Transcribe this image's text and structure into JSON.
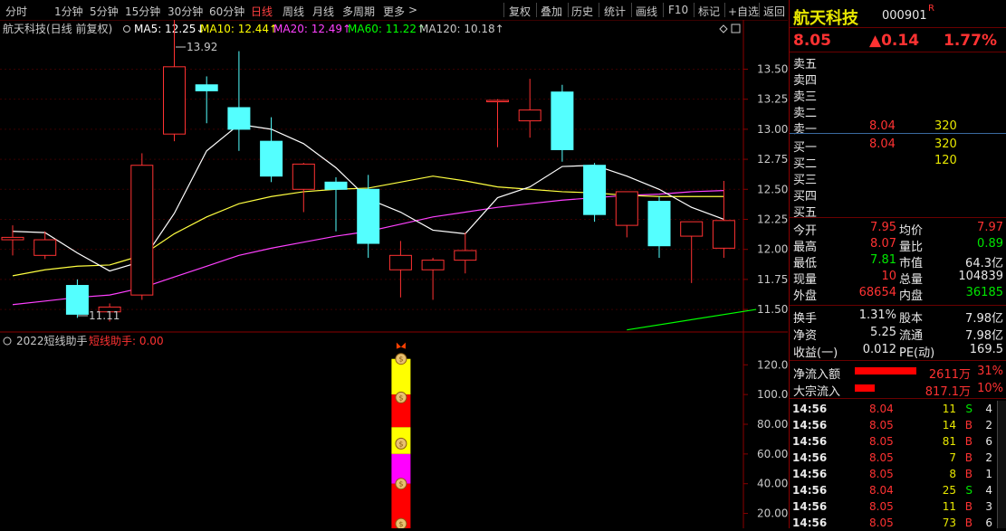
{
  "toolbar": {
    "periods": [
      "分时",
      "1分钟",
      "5分钟",
      "15分钟",
      "30分钟",
      "60分钟",
      "日线",
      "周线",
      "月线",
      "多周期",
      "更多"
    ],
    "active_period": "日线",
    "more_arrow": ">",
    "actions": [
      "复权",
      "叠加",
      "历史",
      "统计",
      "画线",
      "F10",
      "标记",
      "+自选",
      "返回"
    ]
  },
  "main_chart": {
    "title": "航天科技(日线 前复权)",
    "ma": [
      {
        "label": "MA5: 12.25↓",
        "color": "#ffffff"
      },
      {
        "label": "MA10: 12.44↑",
        "color": "#ffff00"
      },
      {
        "label": "MA20: 12.49↑",
        "color": "#ff40ff"
      },
      {
        "label": "MA60: 11.22↑",
        "color": "#00ff00"
      },
      {
        "label": "MA120: 10.18↑",
        "color": "#c8c8c8"
      }
    ],
    "high_label": "13.92",
    "low_label": "11.11"
  },
  "sub_chart": {
    "title": "2022短线助手",
    "indicator": "短线助手: 0.00",
    "money_glyph": "$"
  },
  "chart_data": [
    {
      "type": "candlestick",
      "y_ticks": [
        11.5,
        11.75,
        12.0,
        12.25,
        12.5,
        12.75,
        13.0,
        13.25,
        13.5
      ],
      "ylim": [
        11.35,
        13.85
      ],
      "candles": [
        {
          "o": 12.08,
          "h": 12.2,
          "l": 11.95,
          "c": 12.1
        },
        {
          "o": 11.95,
          "h": 12.15,
          "l": 11.92,
          "c": 12.08
        },
        {
          "o": 11.7,
          "h": 11.75,
          "l": 11.43,
          "c": 11.46
        },
        {
          "o": 11.48,
          "h": 11.55,
          "l": 11.4,
          "c": 11.52
        },
        {
          "o": 11.62,
          "h": 12.8,
          "l": 11.58,
          "c": 12.7
        },
        {
          "o": 12.96,
          "h": 13.92,
          "l": 12.9,
          "c": 13.52
        },
        {
          "o": 13.37,
          "h": 13.44,
          "l": 13.05,
          "c": 13.32
        },
        {
          "o": 13.18,
          "h": 13.65,
          "l": 12.82,
          "c": 13.0
        },
        {
          "o": 12.9,
          "h": 13.1,
          "l": 12.56,
          "c": 12.61
        },
        {
          "o": 12.5,
          "h": 12.72,
          "l": 12.31,
          "c": 12.71
        },
        {
          "o": 12.56,
          "h": 12.6,
          "l": 12.15,
          "c": 12.5
        },
        {
          "o": 12.5,
          "h": 12.62,
          "l": 11.93,
          "c": 12.05
        },
        {
          "o": 11.83,
          "h": 12.07,
          "l": 11.6,
          "c": 11.95
        },
        {
          "o": 11.83,
          "h": 11.93,
          "l": 11.58,
          "c": 11.91
        },
        {
          "o": 11.91,
          "h": 12.14,
          "l": 11.8,
          "c": 11.99
        },
        {
          "o": 13.24,
          "h": 13.25,
          "l": 12.85,
          "c": 13.24
        },
        {
          "o": 13.07,
          "h": 13.42,
          "l": 12.93,
          "c": 13.16
        },
        {
          "o": 13.31,
          "h": 13.37,
          "l": 12.73,
          "c": 12.83
        },
        {
          "o": 12.7,
          "h": 12.72,
          "l": 12.23,
          "c": 12.29
        },
        {
          "o": 12.2,
          "h": 12.4,
          "l": 12.1,
          "c": 12.48
        },
        {
          "o": 12.4,
          "h": 12.44,
          "l": 11.93,
          "c": 12.03
        },
        {
          "o": 12.11,
          "h": 12.21,
          "l": 11.72,
          "c": 12.23
        },
        {
          "o": 12.01,
          "h": 12.57,
          "l": 11.93,
          "c": 12.24
        }
      ],
      "ma5": [
        12.15,
        12.14,
        11.97,
        11.82,
        11.9,
        12.3,
        12.82,
        13.04,
        13.0,
        12.88,
        12.68,
        12.42,
        12.31,
        12.16,
        12.13,
        12.43,
        12.52,
        12.69,
        12.7,
        12.61,
        12.5,
        12.35,
        12.25
      ],
      "ma10": [
        11.78,
        11.83,
        11.86,
        11.87,
        11.95,
        12.13,
        12.27,
        12.38,
        12.44,
        12.48,
        12.5,
        12.51,
        12.56,
        12.61,
        12.57,
        12.52,
        12.5,
        12.48,
        12.47,
        12.45,
        12.44,
        12.44,
        12.44
      ],
      "ma20": [
        11.54,
        11.57,
        11.6,
        11.62,
        11.68,
        11.77,
        11.86,
        11.95,
        12.01,
        12.06,
        12.11,
        12.15,
        12.21,
        12.27,
        12.31,
        12.35,
        12.38,
        12.41,
        12.43,
        12.45,
        12.46,
        12.48,
        12.49
      ],
      "ma60_points": [
        [
          19,
          11.33
        ],
        [
          23,
          11.5
        ]
      ]
    },
    {
      "type": "bar",
      "y_ticks": [
        20,
        40,
        60,
        80,
        100,
        120
      ],
      "ylim": [
        10,
        136
      ],
      "segments": [
        {
          "from": 124,
          "to": 100,
          "color": "#ffff00"
        },
        {
          "from": 100,
          "to": 78,
          "color": "#ff0000"
        },
        {
          "from": 78,
          "to": 60,
          "color": "#ffff00"
        },
        {
          "from": 60,
          "to": 40,
          "color": "#ff00ff"
        },
        {
          "from": 40,
          "to": 10,
          "color": "#ff0000"
        }
      ],
      "coin_levels": [
        124,
        98,
        67,
        40,
        13
      ]
    }
  ],
  "quote": {
    "name": "航天科技",
    "code": "000901",
    "flag": "R",
    "price": "8.05",
    "change": "▲0.14",
    "pct": "1.77%",
    "asks": [
      {
        "label": "卖五",
        "price": "",
        "vol": ""
      },
      {
        "label": "卖四",
        "price": "",
        "vol": ""
      },
      {
        "label": "卖三",
        "price": "",
        "vol": ""
      },
      {
        "label": "卖二",
        "price": "",
        "vol": ""
      },
      {
        "label": "卖一",
        "price": "8.04",
        "vol": "320"
      }
    ],
    "bids": [
      {
        "label": "买一",
        "price": "8.04",
        "vol": "320"
      },
      {
        "label": "买二",
        "price": "",
        "vol": "120"
      },
      {
        "label": "买三",
        "price": "",
        "vol": ""
      },
      {
        "label": "买四",
        "price": "",
        "vol": ""
      },
      {
        "label": "买五",
        "price": "",
        "vol": ""
      }
    ],
    "stats": [
      {
        "l1": "今开",
        "v1": "7.95",
        "c1": "red",
        "l2": "均价",
        "v2": "7.97",
        "c2": "red"
      },
      {
        "l1": "最高",
        "v1": "8.07",
        "c1": "red",
        "l2": "量比",
        "v2": "0.89",
        "c2": "green"
      },
      {
        "l1": "最低",
        "v1": "7.81",
        "c1": "green",
        "l2": "市值",
        "v2": "64.3亿",
        "c2": "white"
      },
      {
        "l1": "现量",
        "v1": "10",
        "c1": "red",
        "l2": "总量",
        "v2": "104839",
        "c2": "white"
      },
      {
        "l1": "外盘",
        "v1": "68654",
        "c1": "red",
        "l2": "内盘",
        "v2": "36185",
        "c2": "green"
      }
    ],
    "fund": [
      {
        "l1": "换手",
        "v1": "1.31%",
        "l2": "股本",
        "v2": "7.98亿"
      },
      {
        "l1": "净资",
        "v1": "5.25",
        "l2": "流通",
        "v2": "7.98亿"
      },
      {
        "l1": "收益(一)",
        "v1": "0.012",
        "l2": "PE(动)",
        "v2": "169.5"
      }
    ],
    "flows": [
      {
        "label": "净流入额",
        "value": "2611万",
        "pct": "31%",
        "bar": 0.31
      },
      {
        "label": "大宗流入",
        "value": "817.1万",
        "pct": "10%",
        "bar": 0.1
      }
    ],
    "ticks": [
      {
        "t": "14:56",
        "p": "8.04",
        "v": "11",
        "side": "S",
        "n": "4"
      },
      {
        "t": "14:56",
        "p": "8.05",
        "v": "14",
        "side": "B",
        "n": "2"
      },
      {
        "t": "14:56",
        "p": "8.05",
        "v": "81",
        "side": "B",
        "n": "6"
      },
      {
        "t": "14:56",
        "p": "8.05",
        "v": "7",
        "side": "B",
        "n": "2"
      },
      {
        "t": "14:56",
        "p": "8.05",
        "v": "8",
        "side": "B",
        "n": "1"
      },
      {
        "t": "14:56",
        "p": "8.04",
        "v": "25",
        "side": "S",
        "n": "4"
      },
      {
        "t": "14:56",
        "p": "8.05",
        "v": "11",
        "side": "B",
        "n": "3"
      },
      {
        "t": "14:56",
        "p": "8.05",
        "v": "73",
        "side": "B",
        "n": "6"
      }
    ]
  }
}
